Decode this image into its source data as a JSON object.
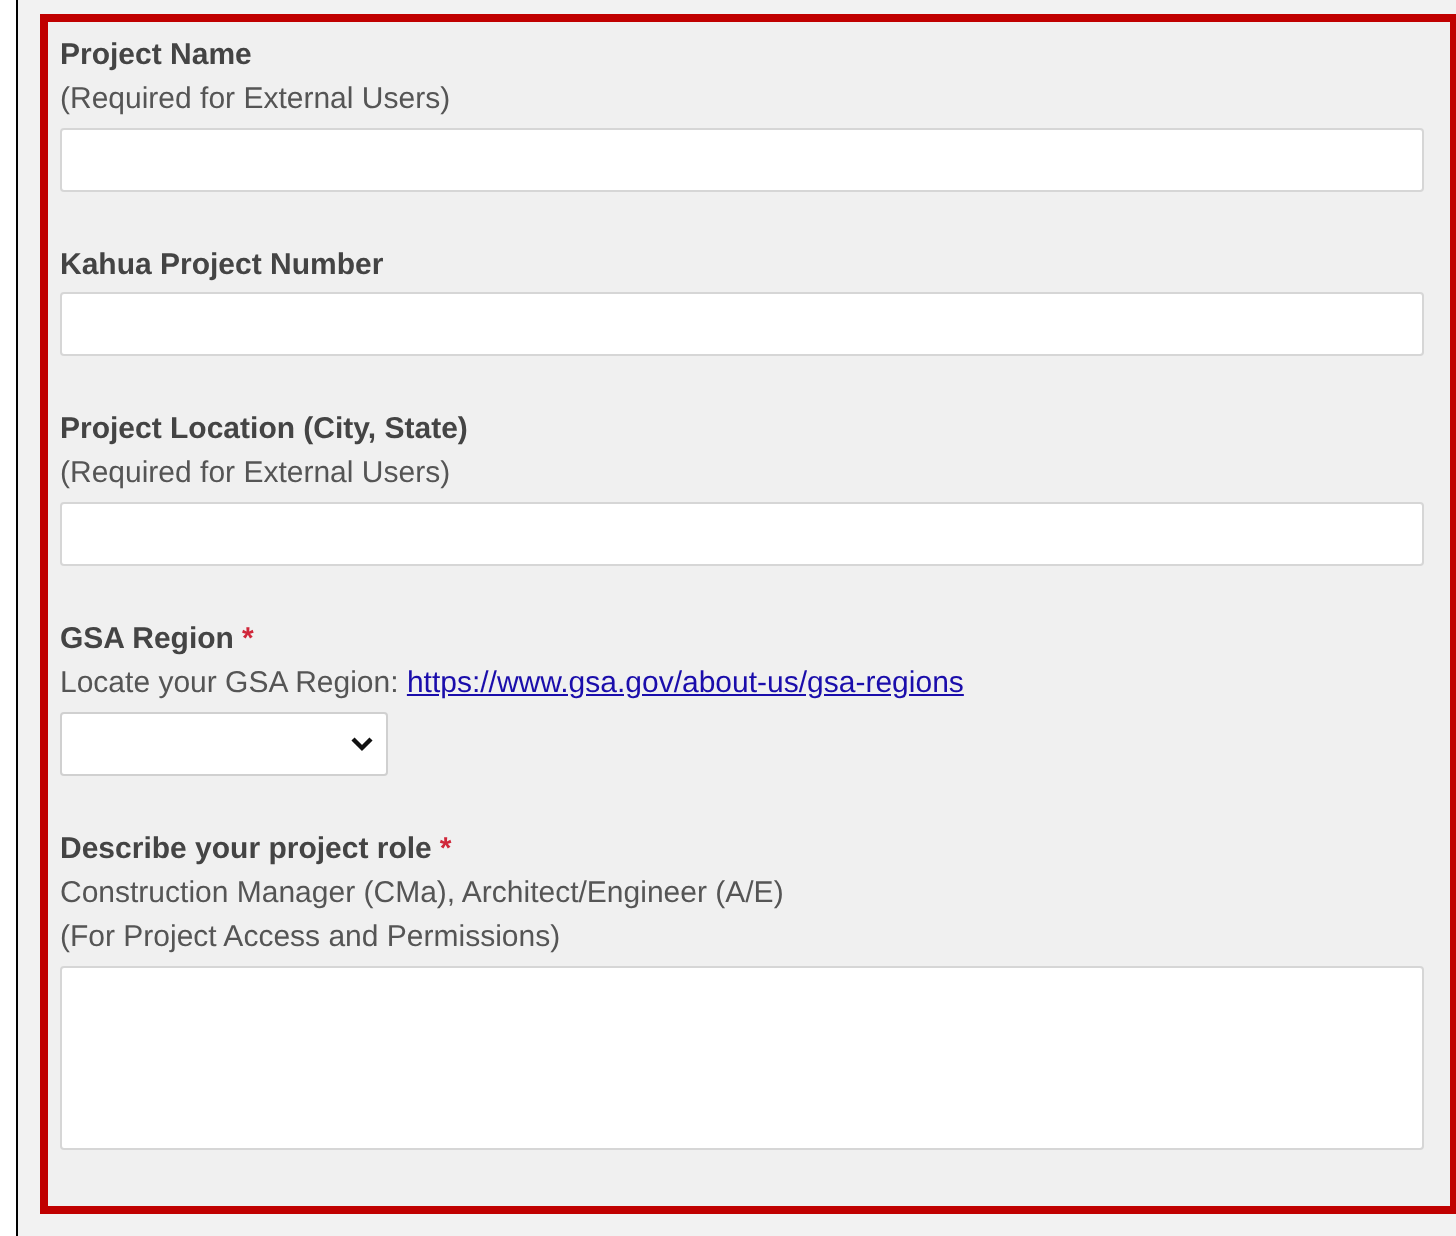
{
  "fields": [
    {
      "kind": "text",
      "label": "Project Name",
      "hints": [
        "(Required for External Users)"
      ]
    },
    {
      "kind": "text",
      "label": "Kahua Project Number"
    },
    {
      "kind": "text",
      "label": "Project Location (City, State)",
      "hints": [
        "(Required for External Users)"
      ]
    },
    {
      "kind": "select",
      "label": "GSA Region",
      "required_mark": "*",
      "hint_link": {
        "text": "Locate your GSA Region:",
        "link": "https://www.gsa.gov/about-us/gsa-regions"
      }
    },
    {
      "kind": "textarea",
      "label": "Describe your project role",
      "required_mark": "*",
      "hints": [
        "Construction Manager (CMa), Architect/Engineer (A/E)",
        "(For Project Access and Permissions)"
      ]
    }
  ]
}
